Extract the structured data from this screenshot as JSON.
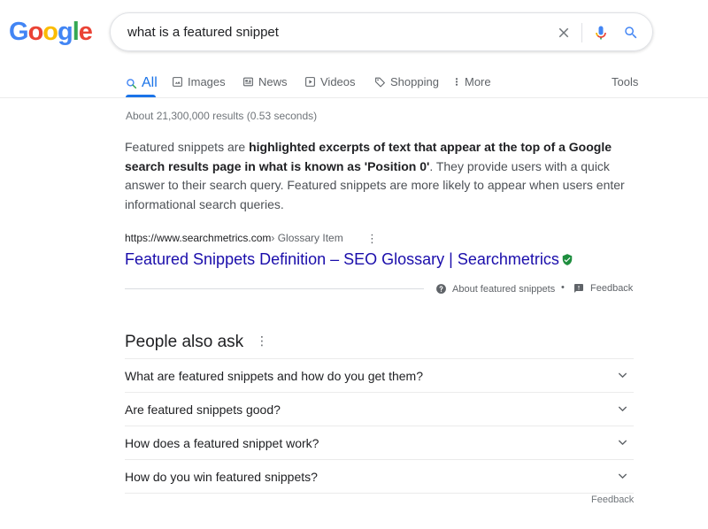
{
  "logo": {
    "letters": [
      "G",
      "o",
      "o",
      "g",
      "l",
      "e"
    ],
    "colors": [
      "#4285F4",
      "#EA4335",
      "#FBBC05",
      "#4285F4",
      "#34A853",
      "#EA4335"
    ]
  },
  "search": {
    "query": "what is a featured snippet",
    "clear_icon": "close-icon",
    "voice_icon": "mic-icon",
    "search_icon": "search-icon"
  },
  "tabs": [
    {
      "label": "All",
      "icon": "search-icon",
      "active": true
    },
    {
      "label": "Images",
      "icon": "image-icon"
    },
    {
      "label": "News",
      "icon": "news-icon"
    },
    {
      "label": "Videos",
      "icon": "video-icon"
    },
    {
      "label": "Shopping",
      "icon": "tag-icon"
    },
    {
      "label": "More",
      "icon": "more-vert-icon"
    }
  ],
  "tools_label": "Tools",
  "stats": "About 21,300,000 results (0.53 seconds)",
  "snippet": {
    "part1": "Featured snippets are ",
    "bold": "highlighted excerpts of text that appear at the top of a Google search results page in what is known as 'Position 0'",
    "part2": ". They provide users with a quick answer to their search query. Featured snippets are more likely to appear when users enter informational search queries."
  },
  "result": {
    "url": "https://www.searchmetrics.com",
    "breadcrumb": " › Glossary Item",
    "menu": "⋮",
    "title": "Featured Snippets Definition – SEO Glossary | Searchmetrics"
  },
  "about_featured": "About featured snippets",
  "separator": "•",
  "feedback_label": "Feedback",
  "paa": {
    "title": "People also ask",
    "menu": "⋮",
    "questions": [
      "What are featured snippets and how do you get them?",
      "Are featured snippets good?",
      "How does a featured snippet work?",
      "How do you win featured snippets?"
    ],
    "feedback": "Feedback"
  },
  "colors": {
    "link": "#1a0dab",
    "accent": "#1a73e8",
    "verified": "#1e8e3e"
  }
}
